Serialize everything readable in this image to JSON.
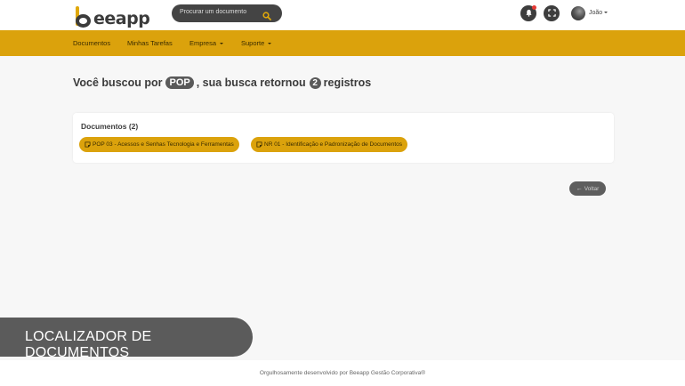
{
  "brand": {
    "logo_text": "eeapp",
    "accent_color": "#dba20c",
    "dark_color": "#3b3b3b"
  },
  "search": {
    "placeholder": "Procurar um documento"
  },
  "user": {
    "name": "João"
  },
  "menu": {
    "items": [
      {
        "label": "Documentos"
      },
      {
        "label": "Minhas Tarefas"
      },
      {
        "label": "Empresa"
      },
      {
        "label": "Suporte"
      }
    ]
  },
  "results": {
    "prefix": "Você buscou por",
    "term": "POP",
    "middle": ", sua busca retornou",
    "count": "2",
    "suffix": "registros"
  },
  "card": {
    "title": "Documentos (2)",
    "documents": [
      {
        "label": "POP 03 - Acessos e Senhas Tecnologia e Ferramentas"
      },
      {
        "label": "NR 01 - Identificação e Padronização de Documentos"
      }
    ]
  },
  "back_button": {
    "label": "Voltar"
  },
  "banner": {
    "text": "LOCALIZADOR DE DOCUMENTOS"
  },
  "footer": {
    "text": "Orgulhosamente desenvolvido por Beeapp Gestão Corporativa®"
  }
}
